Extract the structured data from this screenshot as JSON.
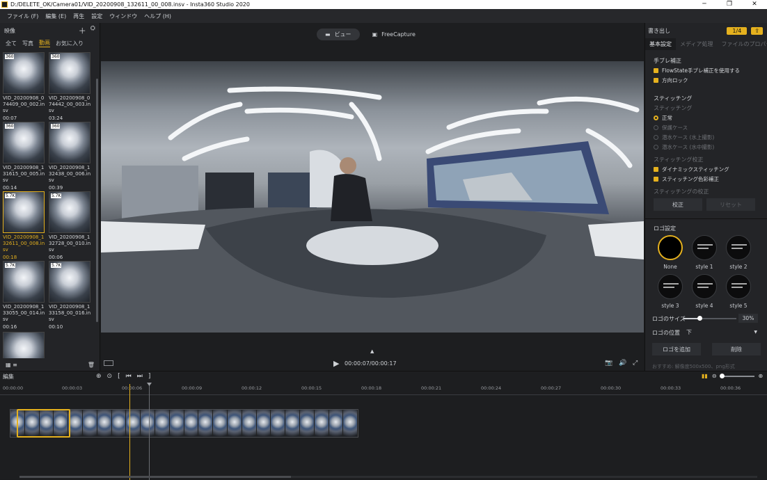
{
  "window": {
    "title": "D:/DELETE_OK/Camera01/VID_20200908_132611_00_008.insv - Insta360 Studio 2020"
  },
  "menu": [
    "ファイル (F)",
    "編集 (E)",
    "再生",
    "設定",
    "ウィンドウ",
    "ヘルプ (H)"
  ],
  "left_panel": {
    "title": "映像",
    "filters": [
      "全て",
      "写真",
      "動画",
      "お気に入り"
    ],
    "active_filter": "動画",
    "items": [
      {
        "name": "VID_20200908_074409_00_002.insv",
        "duration": "00:07",
        "tag": "360",
        "selected": false
      },
      {
        "name": "VID_20200908_074442_00_003.insv",
        "duration": "03:24",
        "tag": "360",
        "selected": false
      },
      {
        "name": "VID_20200908_131615_00_005.insv",
        "duration": "00:14",
        "tag": "360",
        "selected": false
      },
      {
        "name": "VID_20200908_132438_00_006.insv",
        "duration": "00:39",
        "tag": "360",
        "selected": false
      },
      {
        "name": "VID_20200908_132611_00_008.insv",
        "duration": "00:18",
        "tag": "5.7K",
        "selected": true
      },
      {
        "name": "VID_20200908_132728_00_010.insv",
        "duration": "00:06",
        "tag": "5.7K",
        "selected": false
      },
      {
        "name": "VID_20200908_133055_00_014.insv",
        "duration": "00:16",
        "tag": "5.7K",
        "selected": false
      },
      {
        "name": "VID_20200908_133158_00_016.insv",
        "duration": "00:10",
        "tag": "5.7K",
        "selected": false
      },
      {
        "name": "",
        "duration": "",
        "tag": "",
        "selected": false
      }
    ]
  },
  "viewer": {
    "tabs": [
      "ビュー",
      "FreeCapture"
    ],
    "active_tab": "ビュー",
    "time": "00:00:07/00:00:17"
  },
  "right_panel": {
    "title": "書き出し",
    "badge": "1/4",
    "tabs": [
      "基本設定",
      "メディア処理",
      "ファイルのプロパティ"
    ],
    "stabilization": {
      "heading": "手ブレ補正",
      "flowstate": "FlowState手ブレ補正を使用する",
      "direction_lock": "方向ロック"
    },
    "stitching": {
      "heading": "スティッチング",
      "sub": "スティッチング",
      "options": [
        "正常",
        "保護ケース",
        "潜水ケース (水上撮影)",
        "潜水ケース (水中撮影)"
      ],
      "selected": "正常",
      "calib_heading": "スティッチング校正",
      "dynamic": "ダイナミックスティッチング",
      "color": "スティッチング色彩補正",
      "calib_sub": "スティッチングの校正",
      "calibrate_btn": "校正",
      "reset_btn": "リセット"
    },
    "logo": {
      "heading": "ロゴ設定",
      "styles": [
        "None",
        "style 1",
        "style 2",
        "style 3",
        "style 4",
        "style 5"
      ],
      "selected": "None",
      "size_label": "ロゴのサイズ",
      "size_value": "30%",
      "size_fraction": 0.3,
      "position_label": "ロゴの位置",
      "position_value": "下",
      "add_btn": "ロゴを追加",
      "delete_btn": "削除",
      "hint": "おすすめ: 解像度500x500、png形式"
    }
  },
  "timeline": {
    "title": "編集",
    "ruler": [
      "00:00:00",
      "00:00:03",
      "00:00:06",
      "00:00:09",
      "00:00:12",
      "00:00:15",
      "00:00:18",
      "00:00:21",
      "00:00:24",
      "00:00:27",
      "00:00:30",
      "00:00:33",
      "00:00:36"
    ]
  },
  "colors": {
    "accent": "#e5b11e",
    "bg": "#1b1c1e",
    "panel": "#232427"
  }
}
